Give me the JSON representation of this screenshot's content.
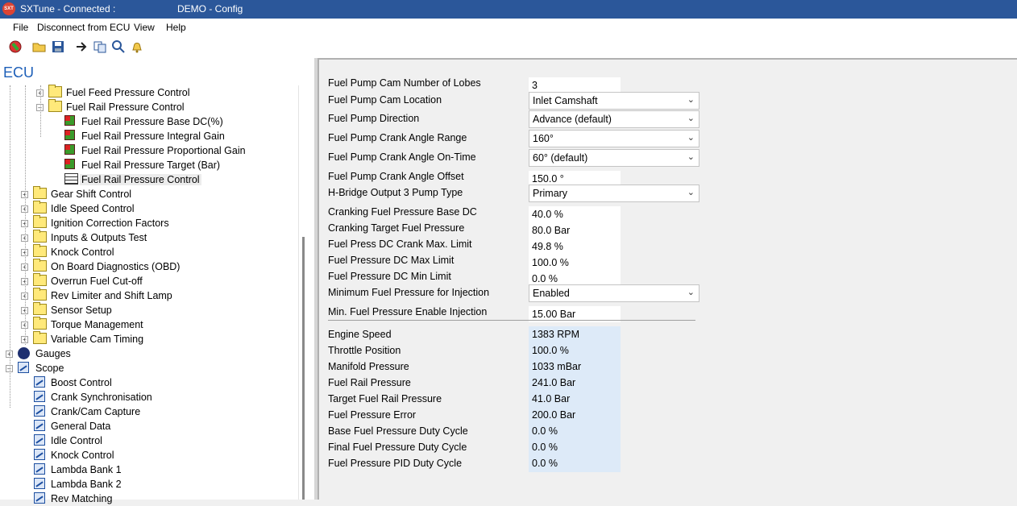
{
  "titlebar": {
    "icon_text": "SXT",
    "app": "SXTune - Connected :",
    "project": "DEMO - Config"
  },
  "menu": {
    "items": [
      "File",
      "Disconnect from ECU",
      "View",
      "Help"
    ]
  },
  "toolbar": {
    "icons": [
      "stop-icon",
      "open-folder-icon",
      "save-icon",
      "arrow-right-icon",
      "copy-icon",
      "search-icon",
      "bell-icon"
    ]
  },
  "tree": {
    "root": "ECU",
    "items": [
      {
        "label": "Fuel Feed Pressure Control",
        "icon": "folder",
        "exp": "+"
      },
      {
        "label": "Fuel Rail Pressure Control",
        "icon": "folder",
        "exp": "-"
      },
      {
        "label": "Fuel Rail Pressure Base DC(%)",
        "icon": "cube"
      },
      {
        "label": "Fuel Rail Pressure Integral Gain",
        "icon": "cube"
      },
      {
        "label": "Fuel Rail Pressure Proportional Gain",
        "icon": "cube"
      },
      {
        "label": "Fuel Rail Pressure Target (Bar)",
        "icon": "cube"
      },
      {
        "label": "Fuel Rail Pressure Control",
        "icon": "grid",
        "selected": true
      },
      {
        "label": "Gear Shift Control",
        "icon": "folder",
        "exp": "+"
      },
      {
        "label": "Idle Speed Control",
        "icon": "folder",
        "exp": "+"
      },
      {
        "label": "Ignition Correction Factors",
        "icon": "folder",
        "exp": "+"
      },
      {
        "label": "Inputs & Outputs Test",
        "icon": "folder",
        "exp": "+"
      },
      {
        "label": "Knock Control",
        "icon": "folder",
        "exp": "+"
      },
      {
        "label": "On Board Diagnostics (OBD)",
        "icon": "folder",
        "exp": "+"
      },
      {
        "label": "Overrun Fuel Cut-off",
        "icon": "folder",
        "exp": "+"
      },
      {
        "label": "Rev Limiter and Shift Lamp",
        "icon": "folder",
        "exp": "+"
      },
      {
        "label": "Sensor Setup",
        "icon": "folder",
        "exp": "+"
      },
      {
        "label": "Torque Management",
        "icon": "folder",
        "exp": "+"
      },
      {
        "label": "Variable Cam Timing",
        "icon": "folder",
        "exp": "+"
      },
      {
        "label": "Gauges",
        "icon": "gauge",
        "exp": "+"
      },
      {
        "label": "Scope",
        "icon": "scope",
        "exp": "-"
      },
      {
        "label": "Boost Control",
        "icon": "scope"
      },
      {
        "label": "Crank Synchronisation",
        "icon": "scope"
      },
      {
        "label": "Crank/Cam Capture",
        "icon": "scope"
      },
      {
        "label": "General Data",
        "icon": "scope"
      },
      {
        "label": "Idle Control",
        "icon": "scope"
      },
      {
        "label": "Knock Control",
        "icon": "scope"
      },
      {
        "label": "Lambda Bank 1",
        "icon": "scope"
      },
      {
        "label": "Lambda Bank 2",
        "icon": "scope"
      },
      {
        "label": "Rev Matching",
        "icon": "scope"
      }
    ]
  },
  "params": [
    {
      "label": "Fuel Pump Cam Number of Lobes",
      "value": "3",
      "type": "text"
    },
    {
      "label": "Fuel Pump Cam Location",
      "value": "Inlet Camshaft",
      "type": "dropdown"
    },
    {
      "label": "Fuel Pump Direction",
      "value": "Advance (default)",
      "type": "dropdown"
    },
    {
      "label": "Fuel Pump Crank Angle Range",
      "value": "160°",
      "type": "dropdown"
    },
    {
      "label": "Fuel Pump Crank Angle On-Time",
      "value": "60° (default)",
      "type": "dropdown"
    },
    {
      "label": "Fuel Pump Crank Angle Offset",
      "value": "150.0 °",
      "type": "text"
    },
    {
      "label": "H-Bridge Output 3 Pump Type",
      "value": "Primary",
      "type": "dropdown"
    },
    {
      "label": "Cranking Fuel Pressure Base DC",
      "value": "40.0 %",
      "type": "text"
    },
    {
      "label": "Cranking Target Fuel Pressure",
      "value": "80.0 Bar",
      "type": "text"
    },
    {
      "label": "Fuel Press DC Crank Max. Limit",
      "value": "49.8 %",
      "type": "text"
    },
    {
      "label": "Fuel Pressure DC Max Limit",
      "value": "100.0 %",
      "type": "text"
    },
    {
      "label": "Fuel Pressure DC Min Limit",
      "value": "0.0 %",
      "type": "text"
    },
    {
      "label": "Minimum Fuel Pressure for Injection",
      "value": "Enabled",
      "type": "dropdown"
    },
    {
      "label": "Min. Fuel Pressure Enable Injection",
      "value": "15.00 Bar",
      "type": "text"
    }
  ],
  "readings": [
    {
      "label": "Engine Speed",
      "value": "1383 RPM"
    },
    {
      "label": "Throttle Position",
      "value": "100.0 %"
    },
    {
      "label": "Manifold Pressure",
      "value": "1033 mBar"
    },
    {
      "label": "Fuel Rail Pressure",
      "value": "241.0 Bar"
    },
    {
      "label": "Target Fuel Rail Pressure",
      "value": "41.0 Bar"
    },
    {
      "label": "Fuel Pressure Error",
      "value": "200.0 Bar"
    },
    {
      "label": "Base Fuel Pressure Duty Cycle",
      "value": "0.0 %"
    },
    {
      "label": "Final Fuel Pressure Duty Cycle",
      "value": "0.0 %"
    },
    {
      "label": "Fuel Pressure PID Duty Cycle",
      "value": "0.0 %"
    }
  ]
}
